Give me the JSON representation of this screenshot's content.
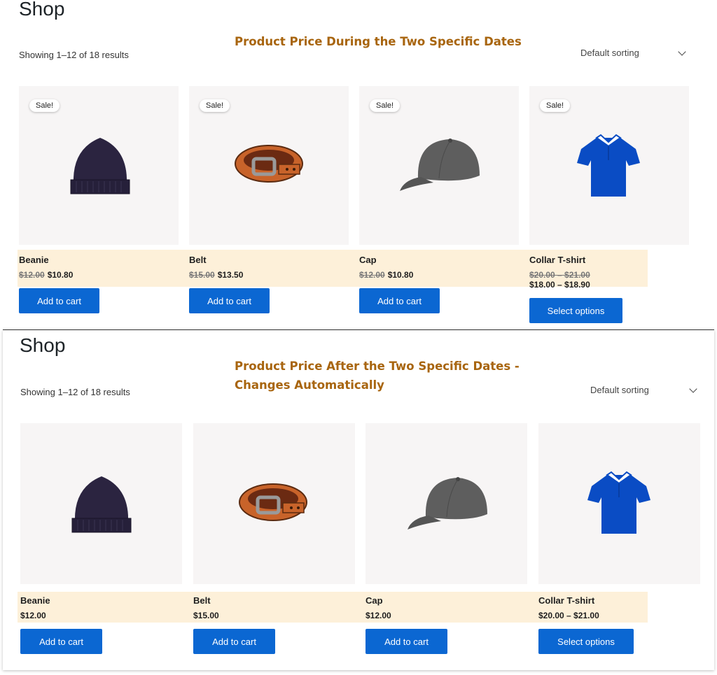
{
  "top": {
    "title": "Shop",
    "annotation": "Product Price During the Two Specific Dates",
    "results": "Showing 1–12 of 18 results",
    "sorting": "Default sorting",
    "sale_badge": "Sale!",
    "products": [
      {
        "name": "Beanie",
        "old_price": "$12.00",
        "price": "$10.80",
        "button": "Add to cart",
        "icon": "beanie-icon"
      },
      {
        "name": "Belt",
        "old_price": "$15.00",
        "price": "$13.50",
        "button": "Add to cart",
        "icon": "belt-icon"
      },
      {
        "name": "Cap",
        "old_price": "$12.00",
        "price": "$10.80",
        "button": "Add to cart",
        "icon": "cap-icon"
      },
      {
        "name": "Collar T-shirt",
        "old_price": "$20.00 – $21.00",
        "price": "$18.00 – $18.90",
        "button": "Select options",
        "icon": "tshirt-icon"
      }
    ]
  },
  "bottom": {
    "title": "Shop",
    "annotation_line1": "Product Price After the Two Specific Dates -",
    "annotation_line2": "Changes Automatically",
    "results": "Showing 1–12 of 18 results",
    "sorting": "Default sorting",
    "products": [
      {
        "name": "Beanie",
        "price": "$12.00",
        "button": "Add to cart",
        "icon": "beanie-icon"
      },
      {
        "name": "Belt",
        "price": "$15.00",
        "button": "Add to cart",
        "icon": "belt-icon"
      },
      {
        "name": "Cap",
        "price": "$12.00",
        "button": "Add to cart",
        "icon": "cap-icon"
      },
      {
        "name": "Collar T-shirt",
        "price": "$20.00 – $21.00",
        "button": "Select options",
        "icon": "tshirt-icon"
      }
    ]
  },
  "colors": {
    "button": "#0b67d2",
    "highlight": "#fdf0d9",
    "annotation": "#a8650f"
  }
}
